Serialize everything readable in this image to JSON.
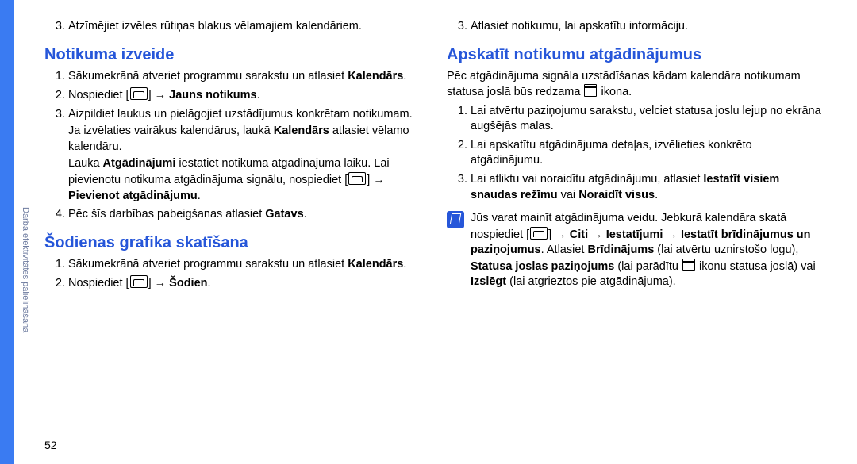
{
  "sidebar": {
    "label": "Darba efektivitātes palielināšana"
  },
  "page_number": "52",
  "left": {
    "intro_list_start": 3,
    "intro_items": [
      "Atzīmējiet izvēles rūtiņas blakus vēlamajiem kalendāriem."
    ],
    "h1": "Notikuma izveide",
    "list1_1": "Sākumekrānā atveriet programmu sarakstu un atlasiet ",
    "list1_1_b": "Kalendārs",
    "list1_1_end": ".",
    "list1_2_a": "Nospiediet [",
    "list1_2_b": "] → ",
    "list1_2_bold": "Jauns notikums",
    "list1_2_end": ".",
    "list1_3": "Aizpildiet laukus un pielāgojiet uzstādījumus konkrētam notikumam.",
    "list1_3_p1a": "Ja izvēlaties vairākus kalendārus, laukā ",
    "list1_3_p1b": "Kalendārs",
    "list1_3_p1c": " atlasiet vēlamo kalendāru.",
    "list1_3_p2a": "Laukā ",
    "list1_3_p2b": "Atgādinājumi",
    "list1_3_p2c": " iestatiet notikuma atgādinājuma laiku. Lai pievienotu notikuma atgādinājuma signālu, nospiediet [",
    "list1_3_p2d": "] → ",
    "list1_3_p2e": "Pievienot atgādinājumu",
    "list1_3_p2f": ".",
    "list1_4_a": "Pēc šīs darbības pabeigšanas atlasiet ",
    "list1_4_b": "Gatavs",
    "list1_4_c": ".",
    "h2": "Šodienas grafika skatīšana",
    "list2_1_a": "Sākumekrānā atveriet programmu sarakstu un atlasiet ",
    "list2_1_b": "Kalendārs",
    "list2_1_c": ".",
    "list2_2_a": "Nospiediet [",
    "list2_2_b": "] → ",
    "list2_2_bold": "Šodien",
    "list2_2_end": "."
  },
  "right": {
    "top_list_start": 3,
    "top1": "Atlasiet notikumu, lai apskatītu informāciju.",
    "h1": "Apskatīt notikumu atgādinājumus",
    "p_a": "Pēc atgādinājuma signāla uzstādīšanas kādam kalendāra notikumam statusa joslā būs redzama ",
    "p_b": " ikona.",
    "list1_1": "Lai atvērtu paziņojumu sarakstu, velciet statusa joslu lejup no ekrāna augšējās malas.",
    "list1_2": "Lai apskatītu atgādinājuma detaļas, izvēlieties konkrēto atgādinājumu.",
    "list1_3_a": "Lai atliktu vai noraidītu atgādinājumu, atlasiet ",
    "list1_3_b": "Iestatīt visiem snaudas režīmu",
    "list1_3_c": " vai ",
    "list1_3_d": "Noraidīt visus",
    "list1_3_e": ".",
    "note_a": "Jūs varat mainīt atgādinājuma veidu. Jebkurā kalendāra skatā nospiediet [",
    "note_b": "] → ",
    "note_c": "Citi",
    "note_d": " → ",
    "note_e": "Iestatījumi",
    "note_f": " → ",
    "note_g": "Iestatīt brīdinājumus un paziņojumus",
    "note_h": ". Atlasiet ",
    "note_i": "Brīdinājums",
    "note_j": " (lai atvērtu uznirstošo logu), ",
    "note_k": "Statusa joslas paziņojums",
    "note_l": " (lai parādītu ",
    "note_m": " ikonu statusa joslā) vai ",
    "note_n": "Izslēgt",
    "note_o": " (lai atgrieztos pie atgādinājuma)."
  }
}
